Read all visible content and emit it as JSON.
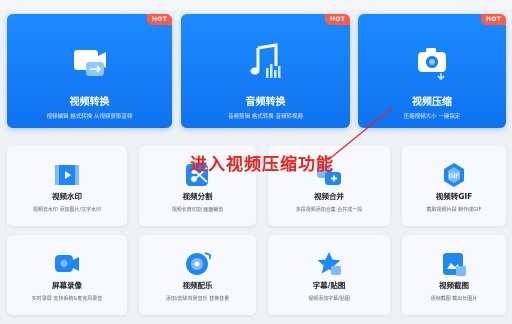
{
  "big_cards": [
    {
      "title": "视频转换",
      "subtitle": "视频编辑 格式转换 从视频获取音频",
      "badge": "HOT",
      "icon": "video-convert-icon"
    },
    {
      "title": "音频转换",
      "subtitle": "音频剪辑 格式转换 音频转视频",
      "badge": "HOT",
      "icon": "audio-convert-icon"
    },
    {
      "title": "视频压缩",
      "subtitle": "压缩视频大小 一键搞定",
      "badge": "HOT",
      "icon": "video-compress-icon"
    }
  ],
  "small_cards": [
    {
      "title": "视频水印",
      "subtitle": "视频去水印 添加图片/文字水印",
      "icon": "video-watermark-icon"
    },
    {
      "title": "视频分割",
      "subtitle": "视频长度切割 画面裁剪",
      "icon": "video-split-icon"
    },
    {
      "title": "视频合并",
      "subtitle": "多段视频添加合集 合并成一段",
      "icon": "video-merge-icon"
    },
    {
      "title": "视频转GIF",
      "subtitle": "截取视频片段 制作成GIF",
      "icon": "video-to-gif-icon"
    },
    {
      "title": "屏幕录像",
      "subtitle": "实时录屏 支持系统&麦克风录音",
      "icon": "screen-record-icon"
    },
    {
      "title": "视频配乐",
      "subtitle": "添加/去除背景音乐 替换音量",
      "icon": "video-music-icon"
    },
    {
      "title": "字幕/贴图",
      "subtitle": "视频添加字幕/贴图",
      "icon": "subtitle-sticker-icon"
    },
    {
      "title": "视频截图",
      "subtitle": "逐帧截图 截出长图片",
      "icon": "video-screenshot-icon"
    }
  ],
  "annotation": {
    "text": "进入视频压缩功能",
    "color": "#e9231f"
  },
  "colors": {
    "primary": "#1380f5",
    "hot": "#ff5a4a",
    "icon_blue": "#1e88f5"
  }
}
